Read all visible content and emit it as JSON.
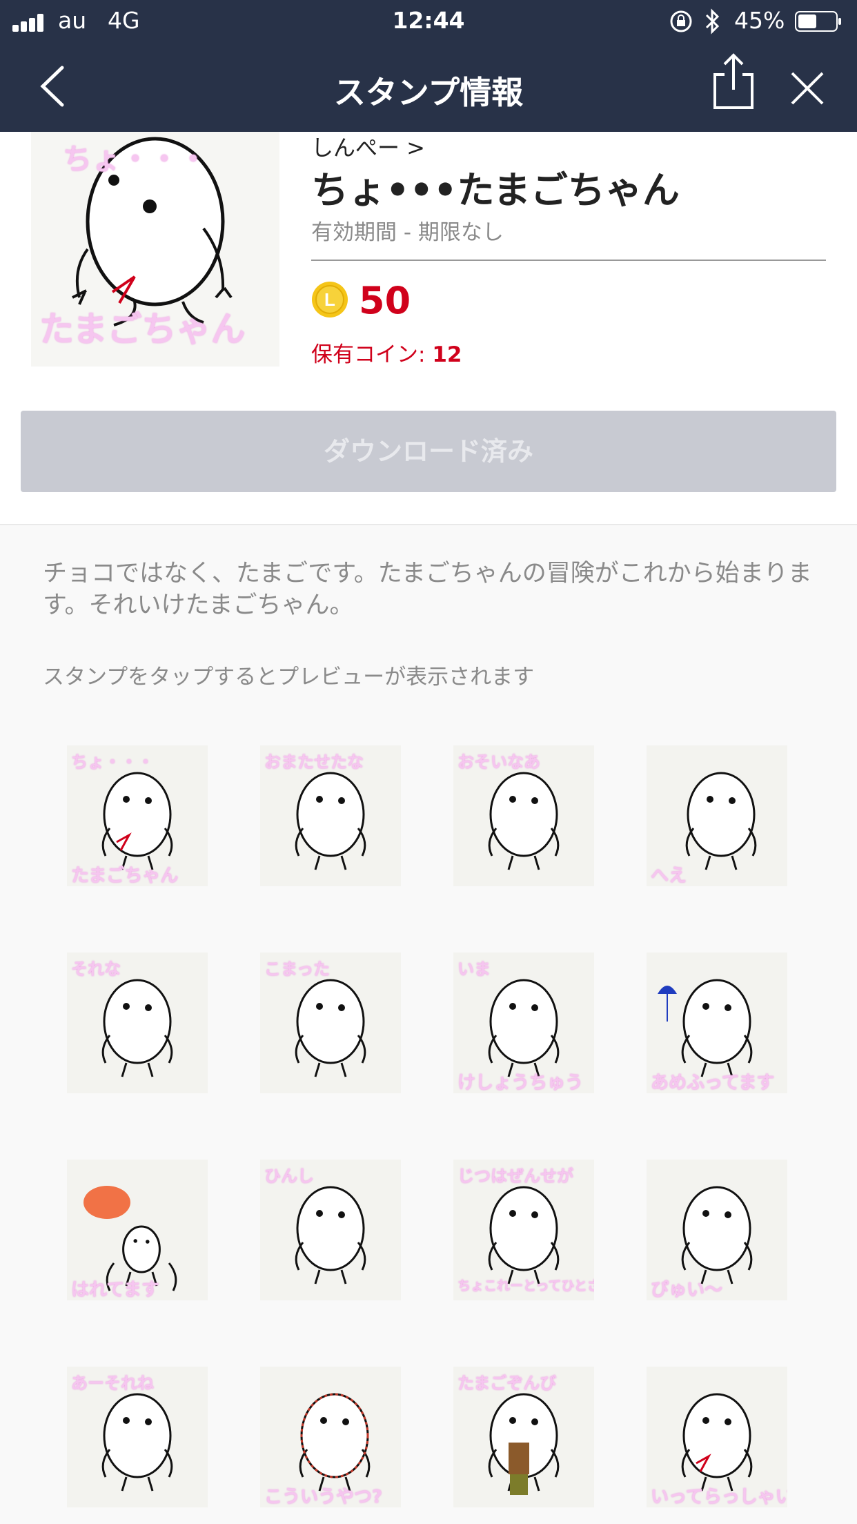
{
  "status_bar": {
    "carrier": "au",
    "network": "4G",
    "time": "12:44",
    "battery_percent": "45%"
  },
  "nav": {
    "title": "スタンプ情報"
  },
  "sticker_pack": {
    "author": "しんぺー >",
    "title": "ちょ•••たまごちゃん",
    "validity": "有効期間 - 期限なし",
    "price": "50",
    "owned_coins_label": "保有コイン: ",
    "owned_coins_value": "12",
    "thumb_caption_top": "ちょ・・・",
    "thumb_caption_bottom": "たまごちゃん",
    "download_label": "ダウンロード済み",
    "description": "チョコではなく、たまごです。たまごちゃんの冒険がこれから始まります。それいけたまごちゃん。",
    "preview_hint": "スタンプをタップするとプレビューが表示されます"
  },
  "stickers": [
    {
      "top": "ちょ・・・",
      "bottom": "たまごちゃん"
    },
    {
      "top": "おまたせたな",
      "bottom": ""
    },
    {
      "top": "おそいなあ",
      "bottom": ""
    },
    {
      "top": "",
      "bottom": "へえ"
    },
    {
      "top": "それな",
      "bottom": ""
    },
    {
      "top": "こまった",
      "bottom": ""
    },
    {
      "top": "いま",
      "bottom": "けしょうちゅう"
    },
    {
      "top": "",
      "bottom": "あめふってます"
    },
    {
      "top": "",
      "bottom": "はれてます"
    },
    {
      "top": "ひんし",
      "bottom": ""
    },
    {
      "top": "じつはぜんせが",
      "bottom": "ちょこれーとってひとさましゅ"
    },
    {
      "top": "",
      "bottom": "ぴゅい〜"
    },
    {
      "top": "あーそれね",
      "bottom": ""
    },
    {
      "top": "",
      "bottom": "こういうやつ?"
    },
    {
      "top": "たまごぞんび",
      "bottom": ""
    },
    {
      "top": "",
      "bottom": "いってらっしゃい"
    }
  ],
  "colors": {
    "nav_bg": "#283248",
    "price": "#d0011b",
    "button_disabled": "#c8cad2",
    "caption_pink": "#f6c6f0"
  }
}
